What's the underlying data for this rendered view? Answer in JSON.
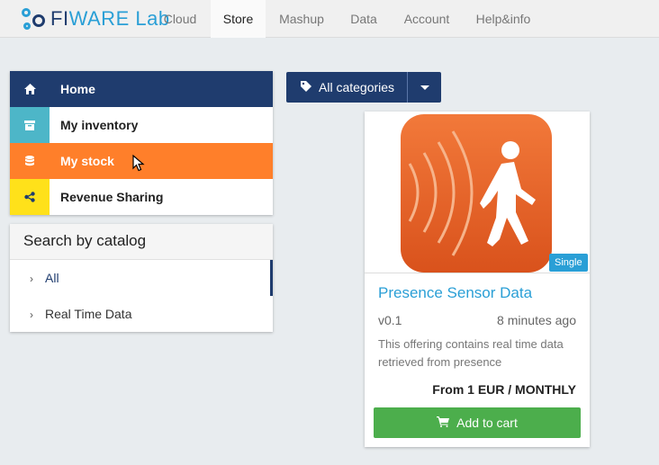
{
  "brand": {
    "name_part1": "FI",
    "name_part2": "WARE Lab",
    "color": "#2a9fd6"
  },
  "topnav": {
    "items": [
      {
        "label": "Cloud"
      },
      {
        "label": "Store"
      },
      {
        "label": "Mashup"
      },
      {
        "label": "Data"
      },
      {
        "label": "Account"
      },
      {
        "label": "Help&info"
      }
    ],
    "active": "Store"
  },
  "side_menu": {
    "items": [
      {
        "label": "Home",
        "icon": "home-icon",
        "color": "#1f3c6e"
      },
      {
        "label": "My inventory",
        "icon": "archive-icon",
        "color": "#4db6c8"
      },
      {
        "label": "My stock",
        "icon": "database-icon",
        "color": "#ff7f2a"
      },
      {
        "label": "Revenue Sharing",
        "icon": "share-icon",
        "color": "#ffe11a"
      }
    ]
  },
  "catalog": {
    "heading": "Search by catalog",
    "items": [
      {
        "label": "All"
      },
      {
        "label": "Real Time Data"
      }
    ]
  },
  "category_filter": {
    "label": "All categories",
    "icon": "tag-icon"
  },
  "offering": {
    "title": "Presence Sensor Data",
    "version": "v0.1",
    "updated": "8 minutes ago",
    "description": "This offering contains real time data retrieved from presence",
    "price": "From 1 EUR / MONTHLY",
    "badge": "Single",
    "button_label": "Add to cart",
    "button_icon": "cart-icon"
  }
}
